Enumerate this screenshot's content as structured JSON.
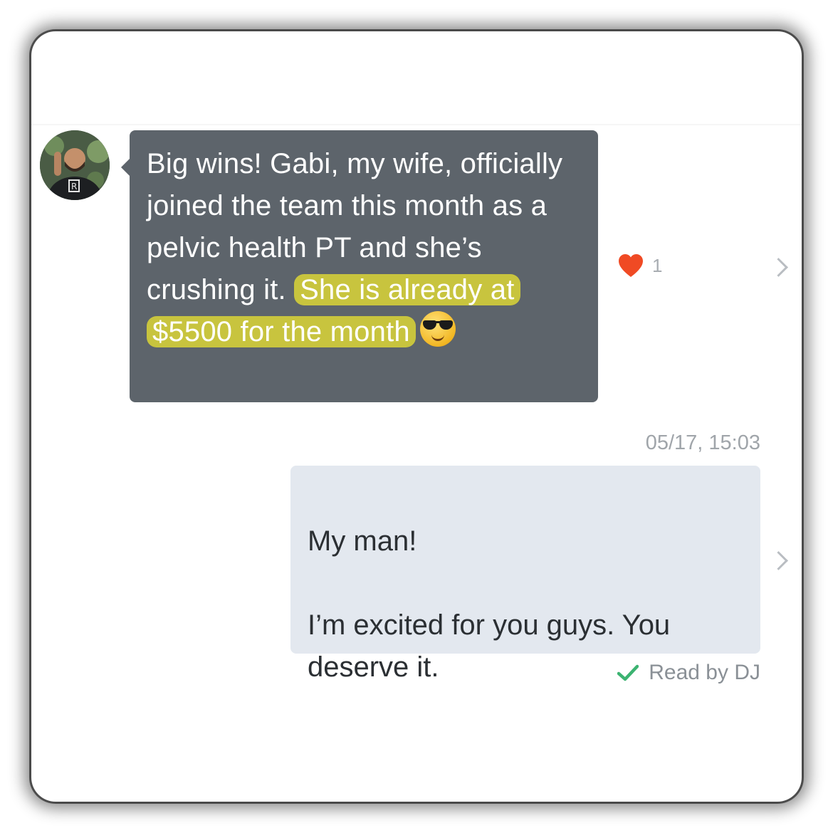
{
  "incoming": {
    "text_plain": "Big wins! Gabi, my wife, officially joined the team this month as a pelvic health PT and she’s crushing it.",
    "text_highlight": "She is already at $5500 for the month",
    "emoji": "smiling-face-with-sunglasses",
    "reaction": {
      "icon": "heart-icon",
      "count": "1"
    }
  },
  "outgoing": {
    "timestamp": "05/17, 15:03",
    "text": "My man!\n\nI’m excited for you guys. You deserve it.",
    "read_receipt": "Read by DJ"
  },
  "colors": {
    "incoming_bubble": "#5d646b",
    "outgoing_bubble": "#e3e8ef",
    "highlight": "#c8c43e",
    "heart": "#f04a24",
    "check": "#3cb371"
  }
}
